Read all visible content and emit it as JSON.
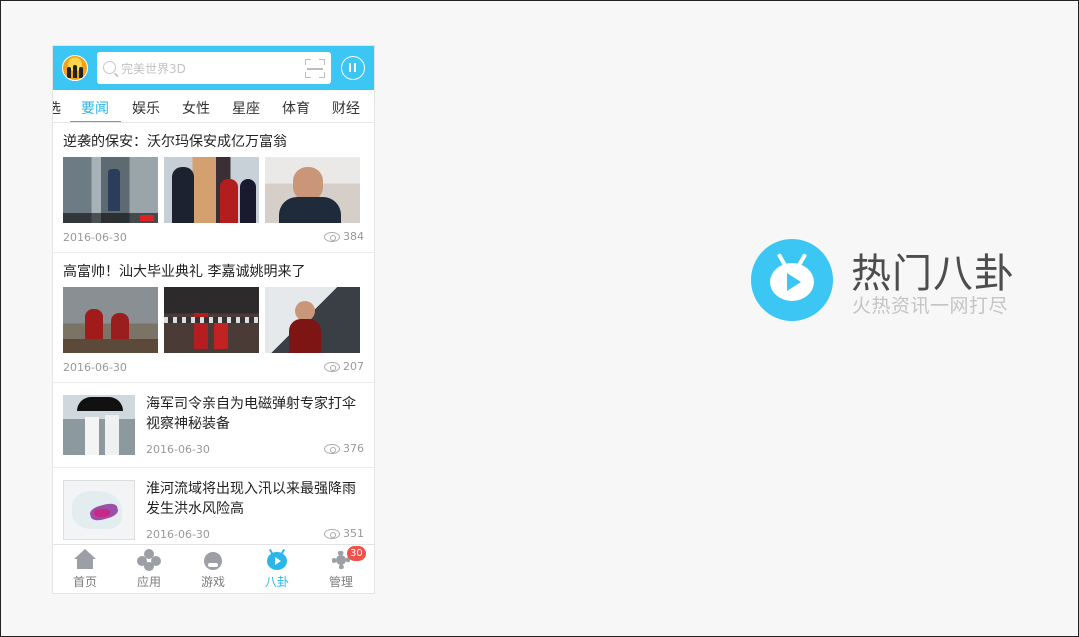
{
  "app": {
    "search_placeholder": "完美世界3D",
    "tabs": [
      "选",
      "要闻",
      "娱乐",
      "女性",
      "星座",
      "体育",
      "财经"
    ],
    "active_tab": "要闻",
    "accent_color": "#3cc6f4"
  },
  "feed": [
    {
      "title": "逆袭的保安：沃尔玛保安成亿万富翁",
      "date": "2016-06-30",
      "views": "384",
      "layout": "three-images"
    },
    {
      "title": "高富帅！汕大毕业典礼 李嘉诚姚明来了",
      "date": "2016-06-30",
      "views": "207",
      "layout": "three-images"
    },
    {
      "title": "海军司令亲自为电磁弹射专家打伞视察神秘装备",
      "date": "2016-06-30",
      "views": "376",
      "layout": "single-image"
    },
    {
      "title": "淮河流域将出现入汛以来最强降雨发生洪水风险高",
      "date": "2016-06-30",
      "views": "351",
      "layout": "single-image"
    }
  ],
  "bottom_nav": [
    {
      "label": "首页",
      "icon": "home-icon"
    },
    {
      "label": "应用",
      "icon": "apps-icon"
    },
    {
      "label": "游戏",
      "icon": "game-icon"
    },
    {
      "label": "八卦",
      "icon": "tv-icon",
      "active": true
    },
    {
      "label": "管理",
      "icon": "gear-icon",
      "badge": "30"
    }
  ],
  "brand": {
    "title": "热门八卦",
    "subtitle": "火热资讯一网打尽"
  }
}
